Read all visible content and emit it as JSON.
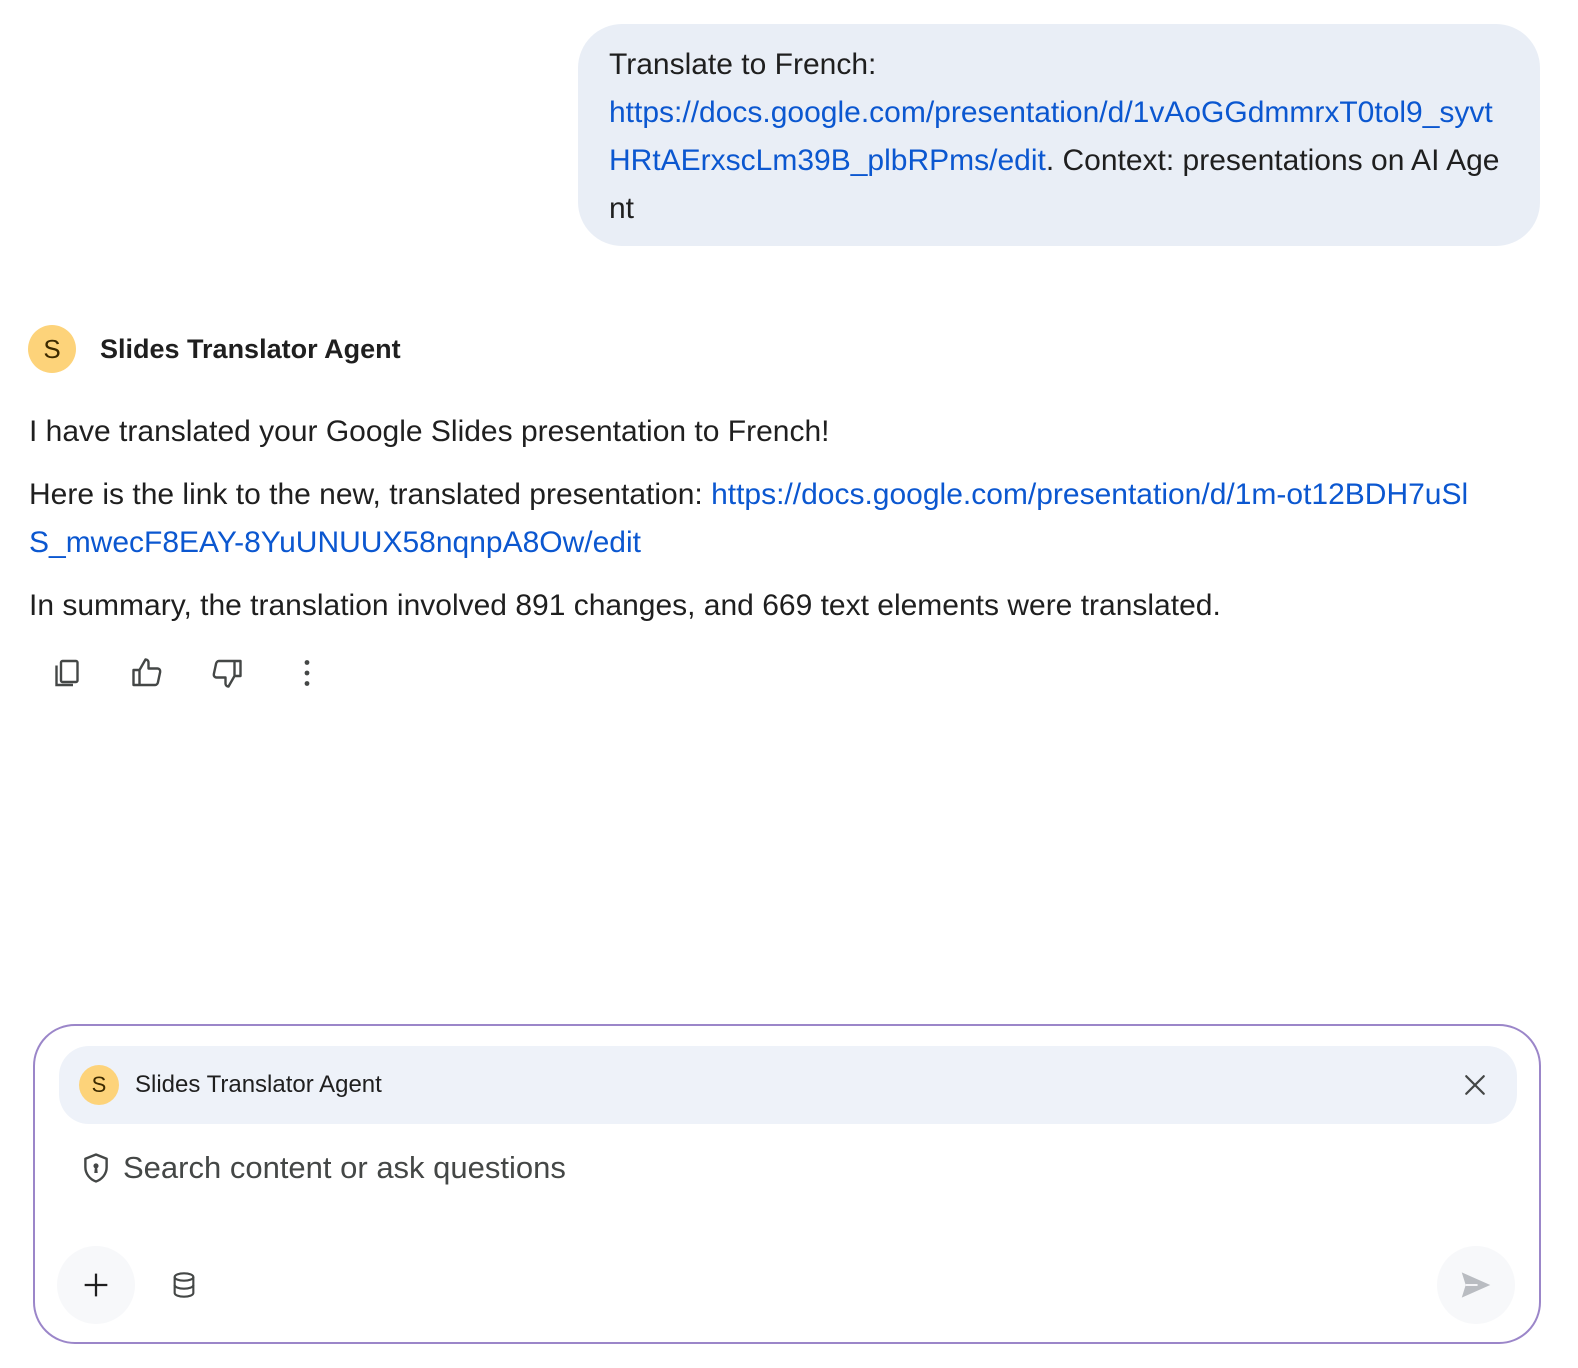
{
  "user_message": {
    "prefix": "Translate to French:",
    "link": "https://docs.google.com/presentation/d/1vAoGGdmmrxT0tol9_syvtHRtAErxscLm39B_plbRPms/edit",
    "suffix": ". Context: presentations on AI Agent"
  },
  "agent": {
    "avatar_letter": "S",
    "name": "Slides Translator Agent",
    "avatar_color": "#fdd37a"
  },
  "response": {
    "line1": "I have translated your Google Slides presentation to French!",
    "line2_prefix": "Here is the link to the new, translated presentation: ",
    "line2_link": "https://docs.google.com/presentation/d/1m-ot12BDH7uSlS_mwecF8EAY-8YuUNUUX58nqnpA8Ow/edit",
    "line3": "In summary, the translation involved 891 changes, and 669 text elements were translated."
  },
  "actions": [
    {
      "icon": "copy-icon"
    },
    {
      "icon": "thumbs-up-icon"
    },
    {
      "icon": "thumbs-down-icon"
    },
    {
      "icon": "more-vert-icon"
    }
  ],
  "composer": {
    "chip_avatar_letter": "S",
    "chip_label": "Slides Translator Agent",
    "search_placeholder": "Search content or ask questions",
    "search_value": "",
    "border_color": "#9b86c9"
  },
  "colors": {
    "link": "#0b57d0",
    "user_bubble_bg": "#e9eef6",
    "chip_bg": "#eef2f9"
  }
}
